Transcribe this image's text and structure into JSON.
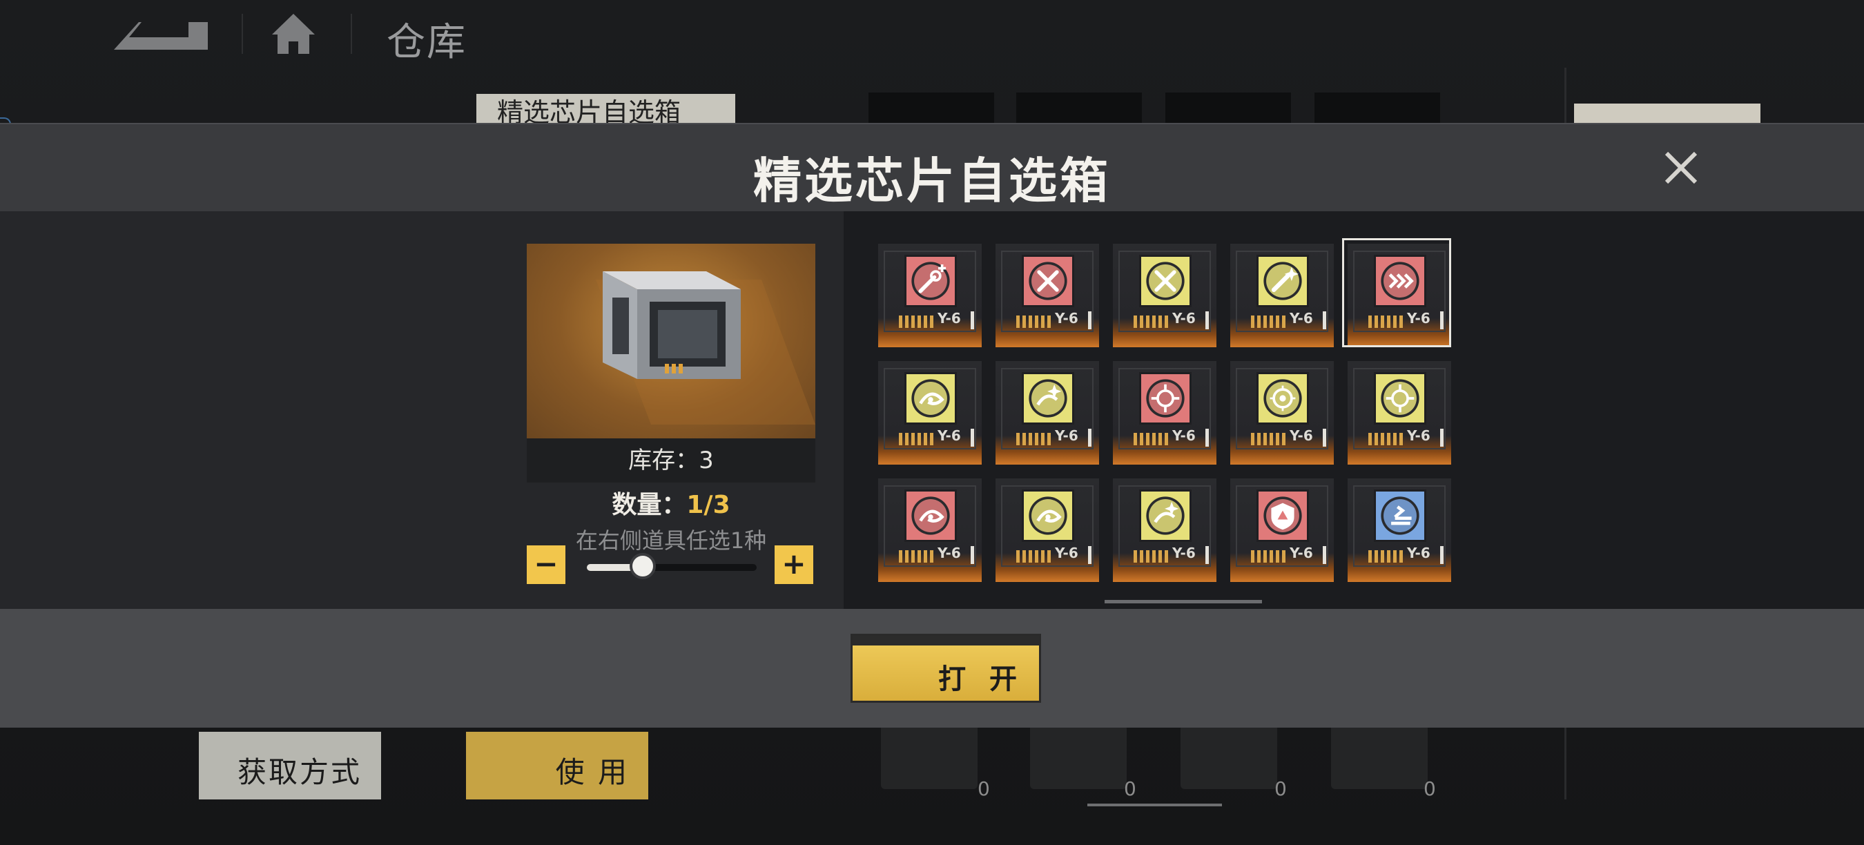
{
  "top_bar": {
    "page_title": "仓库"
  },
  "background": {
    "tab_label": "精选芯片自选箱",
    "get_method_label": "获取方式",
    "use_label": "使 用",
    "chest_counts": [
      "0",
      "0",
      "0",
      "0"
    ]
  },
  "modal": {
    "title": "精选芯片自选箱",
    "stock_label": "库存：3",
    "qty_label": "数量：",
    "qty_value": "1/3",
    "hint": "在右侧道具任选1种",
    "minus": "−",
    "plus": "+",
    "slider_fraction": 0.33,
    "open_label": "打 开"
  },
  "chips": [
    {
      "code": "Y-6",
      "color": "#e07a7a",
      "icon": "wrench-plus-icon",
      "selected": false
    },
    {
      "code": "Y-6",
      "color": "#e07a7a",
      "icon": "crossed-tools-icon",
      "selected": false
    },
    {
      "code": "Y-6",
      "color": "#e6e07a",
      "icon": "crossed-tools-icon",
      "selected": false
    },
    {
      "code": "Y-6",
      "color": "#e6e07a",
      "icon": "spark-bullet-icon",
      "selected": false
    },
    {
      "code": "Y-6",
      "color": "#e07a7a",
      "icon": "arrows-right-icon",
      "selected": true
    },
    {
      "code": "Y-6",
      "color": "#e6e07a",
      "icon": "swirl-icon",
      "selected": false
    },
    {
      "code": "Y-6",
      "color": "#e6e07a",
      "icon": "swirl-spark-icon",
      "selected": false
    },
    {
      "code": "Y-6",
      "color": "#e07a7a",
      "icon": "crosshair-icon",
      "selected": false
    },
    {
      "code": "Y-6",
      "color": "#e6e07a",
      "icon": "target-icon",
      "selected": false
    },
    {
      "code": "Y-6",
      "color": "#e6e07a",
      "icon": "crosshair-icon",
      "selected": false
    },
    {
      "code": "Y-6",
      "color": "#e07a7a",
      "icon": "swirl-icon",
      "selected": false
    },
    {
      "code": "Y-6",
      "color": "#e6e07a",
      "icon": "swirl-icon",
      "selected": false
    },
    {
      "code": "Y-6",
      "color": "#e6e07a",
      "icon": "swirl-spark-icon",
      "selected": false
    },
    {
      "code": "Y-6",
      "color": "#e07a7a",
      "icon": "shield-icon",
      "selected": false
    },
    {
      "code": "Y-6",
      "color": "#7aa6e0",
      "icon": "boost-icon",
      "selected": false
    }
  ]
}
